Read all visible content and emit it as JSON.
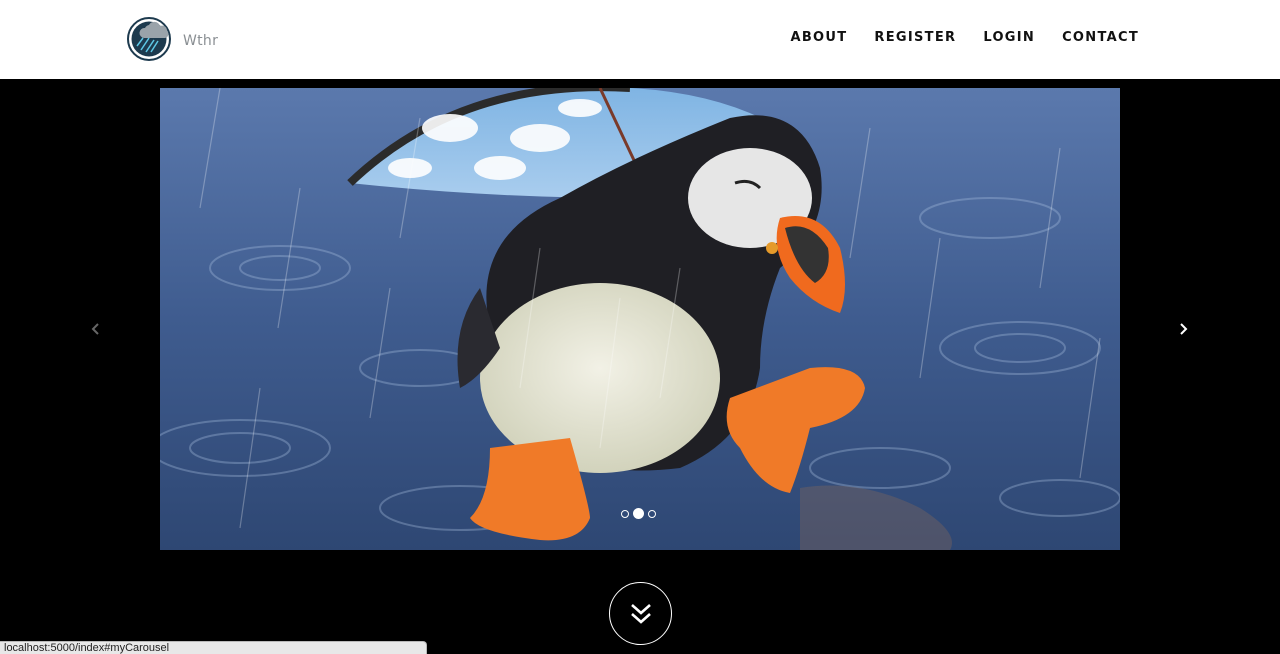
{
  "brand": {
    "name": "Wthr"
  },
  "nav": {
    "items": [
      {
        "label": "ABOUT"
      },
      {
        "label": "REGISTER"
      },
      {
        "label": "LOGIN"
      },
      {
        "label": "CONTACT"
      }
    ]
  },
  "carousel": {
    "slide_count": 3,
    "active_index": 1,
    "prev_icon": "chevron-left-icon",
    "next_icon": "chevron-right-icon"
  },
  "scroll_button": {
    "icon": "double-chevron-down-icon"
  },
  "status_bar": {
    "url": "localhost:5000/index#myCarousel"
  },
  "colors": {
    "navbar_bg": "#ffffff",
    "page_bg": "#000000",
    "logo_circle": "#1d3a4e",
    "nav_text": "#111111"
  }
}
